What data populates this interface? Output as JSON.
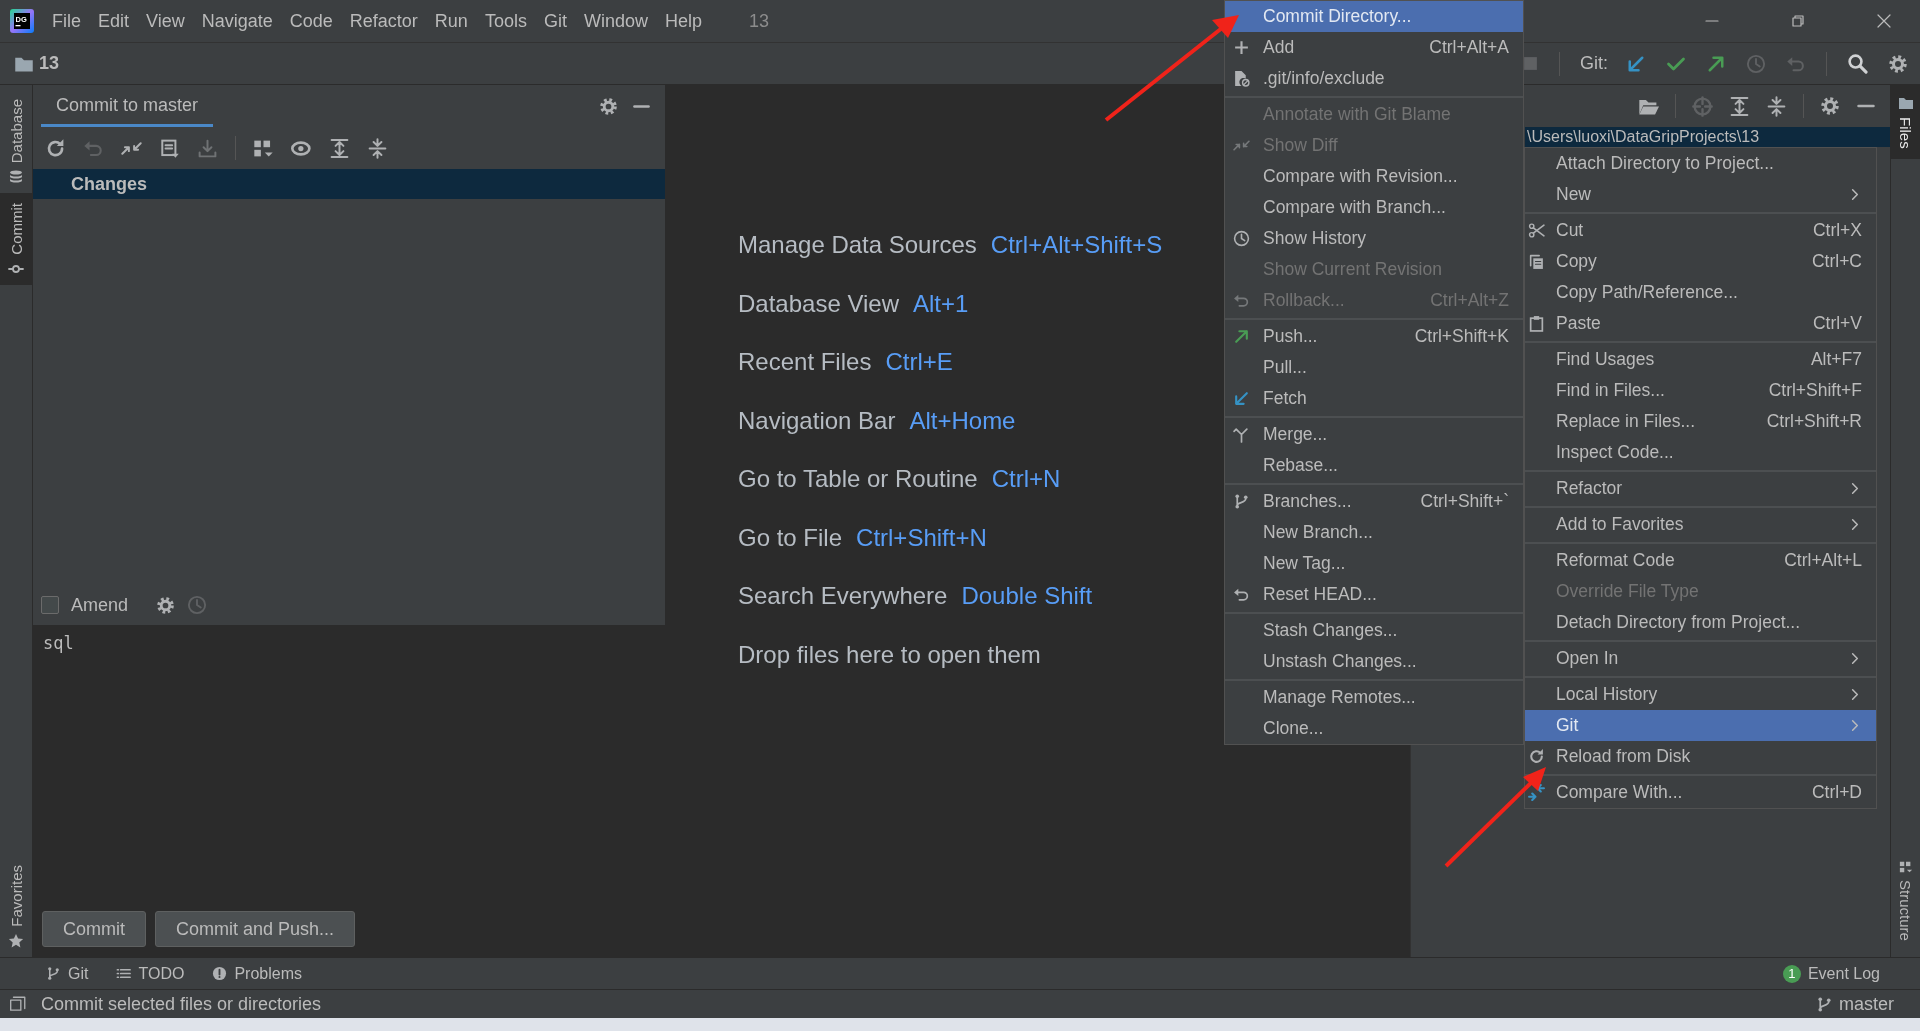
{
  "menubar": {
    "logo": "DG",
    "items": [
      "File",
      "Edit",
      "View",
      "Navigate",
      "Code",
      "Refactor",
      "Run",
      "Tools",
      "Git",
      "Window",
      "Help"
    ],
    "project": "13"
  },
  "navbar": {
    "crumb": "13",
    "git_label": "Git:"
  },
  "left_stripe": [
    {
      "label": "Database",
      "selected": false
    },
    {
      "label": "Commit",
      "selected": true
    }
  ],
  "left_stripe_bottom": {
    "label": "Favorites"
  },
  "commit_panel": {
    "tab": "Commit to master",
    "tree": [
      {
        "label": "Changes",
        "selected": true
      }
    ],
    "amend": {
      "label": "Amend",
      "checked": false
    },
    "message": "sql",
    "buttons": [
      "Commit",
      "Commit and Push..."
    ]
  },
  "editor": {
    "hints": [
      {
        "action": "Manage Data Sources",
        "shortcut": "Ctrl+Alt+Shift+S"
      },
      {
        "action": "Database View",
        "shortcut": "Alt+1"
      },
      {
        "action": "Recent Files",
        "shortcut": "Ctrl+E"
      },
      {
        "action": "Navigation Bar",
        "shortcut": "Alt+Home"
      },
      {
        "action": "Go to Table or Routine",
        "shortcut": "Ctrl+N"
      },
      {
        "action": "Go to File",
        "shortcut": "Ctrl+Shift+N"
      },
      {
        "action": "Search Everywhere",
        "shortcut": "Double Shift"
      },
      {
        "action": "Drop files here to open them"
      }
    ]
  },
  "project_panel": {
    "path": "\\Users\\luoxi\\DataGripProjects\\13"
  },
  "right_stripe": [
    {
      "label": "Files"
    },
    {
      "label": "Structure"
    }
  ],
  "git_menu": {
    "groups": [
      [
        {
          "label": "Commit Directory...",
          "disabled": false,
          "selected": true
        },
        {
          "label": "Add",
          "shortcut": "Ctrl+Alt+A",
          "disabled": false,
          "selected": false
        },
        {
          "label": ".git/info/exclude",
          "disabled": false,
          "selected": false
        }
      ],
      [
        {
          "label": "Annotate with Git Blame",
          "disabled": true,
          "selected": false
        },
        {
          "label": "Show Diff",
          "disabled": true,
          "selected": false
        },
        {
          "label": "Compare with Revision...",
          "disabled": false,
          "selected": false
        },
        {
          "label": "Compare with Branch...",
          "disabled": false,
          "selected": false
        },
        {
          "label": "Show History",
          "disabled": false,
          "selected": false
        },
        {
          "label": "Show Current Revision",
          "disabled": true,
          "selected": false
        },
        {
          "label": "Rollback...",
          "shortcut": "Ctrl+Alt+Z",
          "disabled": true,
          "selected": false
        }
      ],
      [
        {
          "label": "Push...",
          "shortcut": "Ctrl+Shift+K",
          "disabled": false,
          "selected": false
        },
        {
          "label": "Pull...",
          "disabled": false,
          "selected": false
        },
        {
          "label": "Fetch",
          "disabled": false,
          "selected": false
        }
      ],
      [
        {
          "label": "Merge...",
          "disabled": false,
          "selected": false
        },
        {
          "label": "Rebase...",
          "disabled": false,
          "selected": false
        }
      ],
      [
        {
          "label": "Branches...",
          "shortcut": "Ctrl+Shift+`",
          "disabled": false,
          "selected": false
        },
        {
          "label": "New Branch...",
          "disabled": false,
          "selected": false
        },
        {
          "label": "New Tag...",
          "disabled": false,
          "selected": false
        },
        {
          "label": "Reset HEAD...",
          "disabled": false,
          "selected": false
        }
      ],
      [
        {
          "label": "Stash Changes...",
          "disabled": false,
          "selected": false
        },
        {
          "label": "Unstash Changes...",
          "disabled": false,
          "selected": false
        }
      ],
      [
        {
          "label": "Manage Remotes...",
          "disabled": false,
          "selected": false
        },
        {
          "label": "Clone...",
          "disabled": false,
          "selected": false
        }
      ]
    ]
  },
  "context_menu": {
    "groups": [
      [
        {
          "label": "Attach Directory to Project...",
          "disabled": false,
          "selected": false,
          "submenu": false
        },
        {
          "label": "New",
          "disabled": false,
          "selected": false,
          "submenu": true
        }
      ],
      [
        {
          "label": "Cut",
          "shortcut": "Ctrl+X",
          "disabled": false,
          "selected": false,
          "submenu": false
        },
        {
          "label": "Copy",
          "shortcut": "Ctrl+C",
          "disabled": false,
          "selected": false,
          "submenu": false
        },
        {
          "label": "Copy Path/Reference...",
          "disabled": false,
          "selected": false,
          "submenu": false
        },
        {
          "label": "Paste",
          "shortcut": "Ctrl+V",
          "disabled": false,
          "selected": false,
          "submenu": false
        }
      ],
      [
        {
          "label": "Find Usages",
          "shortcut": "Alt+F7",
          "disabled": false,
          "selected": false,
          "submenu": false
        },
        {
          "label": "Find in Files...",
          "shortcut": "Ctrl+Shift+F",
          "disabled": false,
          "selected": false,
          "submenu": false
        },
        {
          "label": "Replace in Files...",
          "shortcut": "Ctrl+Shift+R",
          "disabled": false,
          "selected": false,
          "submenu": false
        },
        {
          "label": "Inspect Code...",
          "disabled": false,
          "selected": false,
          "submenu": false
        }
      ],
      [
        {
          "label": "Refactor",
          "disabled": false,
          "selected": false,
          "submenu": true
        }
      ],
      [
        {
          "label": "Add to Favorites",
          "disabled": false,
          "selected": false,
          "submenu": true
        }
      ],
      [
        {
          "label": "Reformat Code",
          "shortcut": "Ctrl+Alt+L",
          "disabled": false,
          "selected": false,
          "submenu": false
        },
        {
          "label": "Override File Type",
          "disabled": true,
          "selected": false,
          "submenu": false
        },
        {
          "label": "Detach Directory from Project...",
          "disabled": false,
          "selected": false,
          "submenu": false
        }
      ],
      [
        {
          "label": "Open In",
          "disabled": false,
          "selected": false,
          "submenu": true
        }
      ],
      [
        {
          "label": "Local History",
          "disabled": false,
          "selected": false,
          "submenu": true
        },
        {
          "label": "Git",
          "disabled": false,
          "selected": true,
          "submenu": true
        },
        {
          "label": "Reload from Disk",
          "disabled": false,
          "selected": false,
          "submenu": false
        }
      ],
      [
        {
          "label": "Compare With...",
          "shortcut": "Ctrl+D",
          "disabled": false,
          "selected": false,
          "submenu": false
        }
      ]
    ]
  },
  "bottom_tools": [
    {
      "label": "Git"
    },
    {
      "label": "TODO"
    },
    {
      "label": "Problems"
    }
  ],
  "event_log": {
    "badge": "1",
    "label": "Event Log"
  },
  "status_bar": {
    "message": "Commit selected files or directories",
    "branch": "master"
  }
}
